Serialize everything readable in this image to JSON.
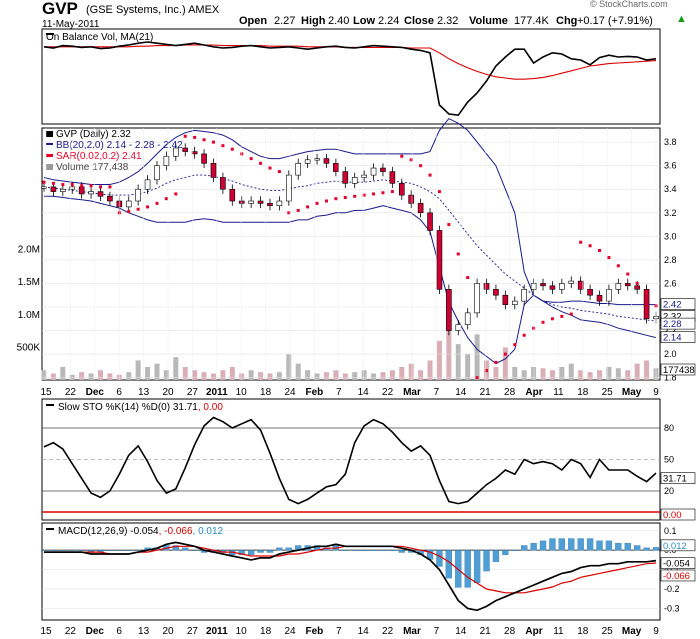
{
  "header": {
    "ticker": "GVP",
    "company": "(GSE Systems, Inc.) AMEX",
    "date": "11-May-2011",
    "open_label": "Open",
    "open": "2.27",
    "high_label": "High",
    "high": "2.40",
    "low_label": "Low",
    "low": "2.24",
    "close_label": "Close",
    "close": "2.32",
    "volume_label": "Volume",
    "volume": "177.4K",
    "chg_label": "Chg",
    "chg": "+0.17 (+7.91%)",
    "chg_icon": "up-triangle-icon",
    "watermark": "© StockCharts.com"
  },
  "colors": {
    "up_candle": "#ffffff",
    "down_candle": "#cc0033",
    "bb_line": "#1a1a8c",
    "sar_dot": "#e8002d",
    "obv_ma": "#dd0000",
    "sto_d": "#dd0000",
    "macd_signal": "#dd0000",
    "hist": "#4f9fd6",
    "volume": "#b8b8b8"
  },
  "chart_data": [
    {
      "type": "line",
      "panel": "obv",
      "legend": [
        "On Balance Vol, MA(21)"
      ],
      "series": [
        {
          "name": "On Balance Vol",
          "values": [
            0.72,
            0.7,
            0.74,
            0.73,
            0.71,
            0.72,
            0.69,
            0.7,
            0.73,
            0.75,
            0.78,
            0.8,
            0.78,
            0.76,
            0.74,
            0.76,
            0.78,
            0.75,
            0.72,
            0.7,
            0.71,
            0.73,
            0.74,
            0.72,
            0.7,
            0.71,
            0.72,
            0.7,
            0.68,
            0.7,
            0.72,
            0.73,
            0.71,
            0.7,
            0.72,
            0.74,
            0.73,
            0.72,
            0.71,
            0.68,
            0.66,
            0.62,
            -0.25,
            -0.4,
            -0.42,
            -0.2,
            -0.05,
            0.15,
            0.4,
            0.55,
            0.68,
            0.68,
            0.45,
            0.55,
            0.62,
            0.6,
            0.52,
            0.5,
            0.42,
            0.54,
            0.58,
            0.55,
            0.56,
            0.55,
            0.5,
            0.52
          ]
        },
        {
          "name": "MA(21)",
          "values": [
            0.72,
            0.72,
            0.72,
            0.72,
            0.72,
            0.72,
            0.72,
            0.72,
            0.72,
            0.72,
            0.73,
            0.73,
            0.74,
            0.74,
            0.74,
            0.75,
            0.75,
            0.75,
            0.75,
            0.74,
            0.74,
            0.74,
            0.74,
            0.74,
            0.73,
            0.73,
            0.73,
            0.73,
            0.72,
            0.72,
            0.72,
            0.72,
            0.71,
            0.71,
            0.71,
            0.71,
            0.71,
            0.71,
            0.71,
            0.7,
            0.7,
            0.7,
            0.62,
            0.52,
            0.44,
            0.37,
            0.31,
            0.26,
            0.22,
            0.2,
            0.18,
            0.18,
            0.19,
            0.21,
            0.24,
            0.28,
            0.32,
            0.36,
            0.4,
            0.42,
            0.44,
            0.45,
            0.46,
            0.47,
            0.48,
            0.49
          ]
        }
      ]
    },
    {
      "type": "candlestick",
      "panel": "price",
      "legend": [
        {
          "prefix": "GVP (Daily) ",
          "value": "2.32"
        },
        {
          "prefix": "BB(20,2.0) ",
          "value": "2.14 - 2.28 - 2.42"
        },
        {
          "prefix": "SAR(0.02,0.2) ",
          "value": "2.41"
        },
        {
          "prefix": "Volume ",
          "value": "177,438"
        }
      ],
      "y_ticks": [
        "3.8",
        "3.6",
        "3.4",
        "3.2",
        "3.0",
        "2.8",
        "2.6",
        "2.4",
        "2.2",
        "2.0",
        "1.8"
      ],
      "volume_ticks": [
        "2.0M",
        "1.5M",
        "1.0M",
        "500K"
      ],
      "last_labels": [
        "2.42",
        "2.32",
        "2.28",
        "2.14"
      ],
      "volume_last": "177438",
      "x_ticks": [
        "15",
        "22",
        "Dec",
        "6",
        "13",
        "20",
        "27",
        "2011",
        "10",
        "18",
        "24",
        "Feb",
        "7",
        "14",
        "22",
        "Mar",
        "7",
        "14",
        "21",
        "28",
        "Apr",
        "11",
        "18",
        "25",
        "May",
        "9"
      ],
      "close": [
        3.42,
        3.38,
        3.4,
        3.42,
        3.36,
        3.38,
        3.34,
        3.3,
        3.25,
        3.3,
        3.4,
        3.48,
        3.6,
        3.68,
        3.75,
        3.72,
        3.7,
        3.62,
        3.5,
        3.4,
        3.3,
        3.28,
        3.3,
        3.28,
        3.26,
        3.3,
        3.52,
        3.62,
        3.65,
        3.66,
        3.62,
        3.55,
        3.45,
        3.5,
        3.52,
        3.58,
        3.55,
        3.45,
        3.35,
        3.28,
        3.2,
        3.05,
        2.55,
        2.2,
        2.25,
        2.35,
        2.6,
        2.55,
        2.5,
        2.42,
        2.45,
        2.55,
        2.6,
        2.58,
        2.55,
        2.6,
        2.62,
        2.55,
        2.5,
        2.45,
        2.55,
        2.6,
        2.58,
        2.55,
        2.3,
        2.32
      ],
      "volume": [
        0.15,
        0.1,
        0.2,
        0.08,
        0.12,
        0.1,
        0.15,
        0.1,
        0.08,
        0.12,
        0.3,
        0.2,
        0.25,
        0.15,
        0.35,
        0.2,
        0.15,
        0.12,
        0.1,
        0.15,
        0.2,
        0.1,
        0.15,
        0.12,
        0.1,
        0.12,
        0.4,
        0.25,
        0.15,
        0.1,
        0.12,
        0.15,
        0.1,
        0.12,
        0.15,
        0.1,
        0.12,
        0.15,
        0.2,
        0.25,
        0.15,
        0.3,
        0.6,
        0.8,
        0.55,
        0.4,
        0.7,
        0.3,
        0.2,
        0.5,
        0.2,
        0.15,
        0.2,
        0.18,
        0.15,
        0.2,
        0.25,
        0.15,
        0.12,
        0.15,
        0.2,
        0.18,
        0.15,
        0.25,
        0.3,
        0.18
      ],
      "bb_upper": [
        3.5,
        3.48,
        3.47,
        3.46,
        3.45,
        3.44,
        3.44,
        3.44,
        3.46,
        3.5,
        3.55,
        3.62,
        3.7,
        3.78,
        3.84,
        3.88,
        3.9,
        3.89,
        3.88,
        3.86,
        3.82,
        3.76,
        3.72,
        3.68,
        3.66,
        3.66,
        3.68,
        3.7,
        3.72,
        3.73,
        3.74,
        3.74,
        3.72,
        3.7,
        3.7,
        3.7,
        3.7,
        3.7,
        3.7,
        3.7,
        3.7,
        3.72,
        3.9,
        4.0,
        3.96,
        3.9,
        3.8,
        3.7,
        3.6,
        3.4,
        3.2,
        2.7,
        2.5,
        2.45,
        2.44,
        2.44,
        2.45,
        2.45,
        2.44,
        2.43,
        2.43,
        2.42,
        2.42,
        2.42,
        2.42,
        2.42
      ],
      "bb_mid": [
        3.42,
        3.41,
        3.4,
        3.39,
        3.38,
        3.37,
        3.36,
        3.35,
        3.35,
        3.35,
        3.36,
        3.38,
        3.41,
        3.45,
        3.48,
        3.5,
        3.52,
        3.52,
        3.51,
        3.49,
        3.47,
        3.44,
        3.42,
        3.4,
        3.39,
        3.39,
        3.4,
        3.42,
        3.43,
        3.45,
        3.46,
        3.47,
        3.46,
        3.46,
        3.46,
        3.47,
        3.48,
        3.47,
        3.46,
        3.45,
        3.42,
        3.38,
        3.32,
        3.22,
        3.12,
        3.02,
        2.92,
        2.84,
        2.76,
        2.68,
        2.62,
        2.56,
        2.5,
        2.45,
        2.42,
        2.4,
        2.39,
        2.37,
        2.36,
        2.35,
        2.34,
        2.32,
        2.31,
        2.3,
        2.29,
        2.28
      ],
      "bb_lower": [
        3.34,
        3.34,
        3.33,
        3.32,
        3.31,
        3.3,
        3.28,
        3.26,
        3.24,
        3.2,
        3.17,
        3.14,
        3.12,
        3.12,
        3.12,
        3.12,
        3.14,
        3.15,
        3.14,
        3.12,
        3.12,
        3.12,
        3.12,
        3.12,
        3.12,
        3.12,
        3.12,
        3.14,
        3.14,
        3.17,
        3.18,
        3.2,
        3.2,
        3.22,
        3.22,
        3.24,
        3.26,
        3.24,
        3.22,
        3.2,
        3.14,
        3.04,
        2.74,
        2.44,
        2.28,
        2.14,
        2.04,
        1.98,
        1.92,
        1.96,
        2.04,
        2.42,
        2.5,
        2.45,
        2.4,
        2.36,
        2.33,
        2.29,
        2.28,
        2.27,
        2.25,
        2.22,
        2.2,
        2.18,
        2.16,
        2.14
      ],
      "sar": [
        3.46,
        3.45,
        3.44,
        3.44,
        3.43,
        3.43,
        3.42,
        3.42,
        3.2,
        3.21,
        3.23,
        3.25,
        3.28,
        3.32,
        3.36,
        3.85,
        3.84,
        3.82,
        3.8,
        3.77,
        3.74,
        3.7,
        3.66,
        3.62,
        3.58,
        3.55,
        3.2,
        3.22,
        3.25,
        3.28,
        3.3,
        3.32,
        3.33,
        3.34,
        3.35,
        3.36,
        3.37,
        3.38,
        3.68,
        3.65,
        3.6,
        3.52,
        3.38,
        3.1,
        2.85,
        2.65,
        1.8,
        1.86,
        1.93,
        2.0,
        2.08,
        2.16,
        2.22,
        2.27,
        2.3,
        2.32,
        2.34,
        2.95,
        2.92,
        2.88,
        2.82,
        2.75,
        2.68,
        2.6,
        2.52,
        2.41
      ]
    },
    {
      "type": "line",
      "panel": "sto",
      "legend": [
        {
          "prefix": "Slow STO %K(14) %D(0) ",
          "value": "31.71"
        },
        {
          "prefix": ", ",
          "value": "0.00"
        }
      ],
      "y_ticks": [
        "80",
        "50",
        "20"
      ],
      "last_labels": [
        "31.71",
        "0.00"
      ],
      "series": [
        {
          "name": "%K(14)",
          "values": [
            62,
            66,
            60,
            46,
            32,
            18,
            14,
            20,
            36,
            54,
            63,
            48,
            30,
            18,
            22,
            42,
            64,
            82,
            90,
            86,
            80,
            84,
            88,
            78,
            56,
            32,
            12,
            8,
            12,
            18,
            24,
            26,
            36,
            66,
            82,
            88,
            84,
            76,
            66,
            58,
            63,
            54,
            30,
            10,
            8,
            10,
            18,
            26,
            32,
            40,
            36,
            50,
            46,
            48,
            46,
            40,
            50,
            46,
            33,
            50,
            40,
            40,
            40,
            34,
            29,
            37
          ]
        },
        {
          "name": "%D(0)",
          "values": [
            0,
            0,
            0,
            0,
            0,
            0,
            0,
            0,
            0,
            0,
            0,
            0,
            0,
            0,
            0,
            0,
            0,
            0,
            0,
            0,
            0,
            0,
            0,
            0,
            0,
            0,
            0,
            0,
            0,
            0,
            0,
            0,
            0,
            0,
            0,
            0,
            0,
            0,
            0,
            0,
            0,
            0,
            0,
            0,
            0,
            0,
            0,
            0,
            0,
            0,
            0,
            0,
            0,
            0,
            0,
            0,
            0,
            0,
            0,
            0,
            0,
            0,
            0,
            0,
            0,
            0
          ]
        }
      ]
    },
    {
      "type": "line",
      "panel": "macd",
      "legend": [
        {
          "prefix": "MACD(12,26,9) ",
          "value": "-0.054"
        },
        {
          "prefix": ", ",
          "value": "-0.066"
        },
        {
          "prefix": ", ",
          "value": "0.012"
        }
      ],
      "y_ticks": [
        "0.1",
        "0.0",
        "-0.1",
        "-0.2",
        "-0.3"
      ],
      "last_labels": [
        "0.012",
        "-0.054",
        "-0.066"
      ],
      "series": [
        {
          "name": "MACD",
          "values": [
            -0.01,
            -0.01,
            -0.01,
            -0.01,
            -0.01,
            -0.02,
            -0.02,
            -0.02,
            -0.02,
            -0.02,
            -0.01,
            0.0,
            0.01,
            0.03,
            0.04,
            0.03,
            0.02,
            0.0,
            -0.01,
            -0.02,
            -0.03,
            -0.04,
            -0.05,
            -0.04,
            -0.04,
            -0.02,
            -0.01,
            0.0,
            0.01,
            0.02,
            0.02,
            0.03,
            0.02,
            0.02,
            0.02,
            0.02,
            0.02,
            0.02,
            0.01,
            0.0,
            -0.02,
            -0.05,
            -0.1,
            -0.18,
            -0.26,
            -0.3,
            -0.31,
            -0.29,
            -0.26,
            -0.24,
            -0.22,
            -0.2,
            -0.18,
            -0.16,
            -0.14,
            -0.12,
            -0.11,
            -0.09,
            -0.08,
            -0.08,
            -0.07,
            -0.07,
            -0.06,
            -0.06,
            -0.06,
            -0.054
          ]
        },
        {
          "name": "Signal",
          "values": [
            -0.01,
            -0.01,
            -0.01,
            -0.01,
            -0.01,
            -0.01,
            -0.01,
            -0.02,
            -0.02,
            -0.02,
            -0.01,
            -0.01,
            0.0,
            0.01,
            0.02,
            0.02,
            0.02,
            0.01,
            0.0,
            -0.01,
            -0.01,
            -0.02,
            -0.03,
            -0.03,
            -0.03,
            -0.03,
            -0.02,
            -0.02,
            -0.01,
            0.0,
            0.01,
            0.01,
            0.02,
            0.02,
            0.02,
            0.02,
            0.02,
            0.02,
            0.02,
            0.01,
            0.0,
            -0.01,
            -0.03,
            -0.06,
            -0.1,
            -0.14,
            -0.17,
            -0.2,
            -0.21,
            -0.22,
            -0.22,
            -0.22,
            -0.21,
            -0.2,
            -0.19,
            -0.17,
            -0.16,
            -0.14,
            -0.13,
            -0.12,
            -0.11,
            -0.1,
            -0.09,
            -0.08,
            -0.07,
            -0.066
          ]
        },
        {
          "name": "Histogram",
          "values": [
            0.0,
            0.0,
            0.0,
            0.0,
            0.0,
            -0.01,
            -0.01,
            0.0,
            0.0,
            0.0,
            0.0,
            0.01,
            0.01,
            0.02,
            0.02,
            0.01,
            0.0,
            -0.01,
            -0.01,
            -0.01,
            -0.02,
            -0.02,
            -0.02,
            -0.01,
            -0.01,
            0.01,
            0.01,
            0.02,
            0.02,
            0.02,
            0.01,
            0.02,
            0.0,
            0.0,
            0.0,
            0.0,
            0.0,
            0.0,
            -0.01,
            -0.01,
            -0.02,
            -0.04,
            -0.07,
            -0.12,
            -0.16,
            -0.16,
            -0.14,
            -0.09,
            -0.05,
            -0.02,
            0.0,
            0.02,
            0.03,
            0.04,
            0.05,
            0.05,
            0.05,
            0.05,
            0.05,
            0.04,
            0.04,
            0.03,
            0.03,
            0.02,
            0.01,
            0.012
          ]
        }
      ]
    }
  ]
}
